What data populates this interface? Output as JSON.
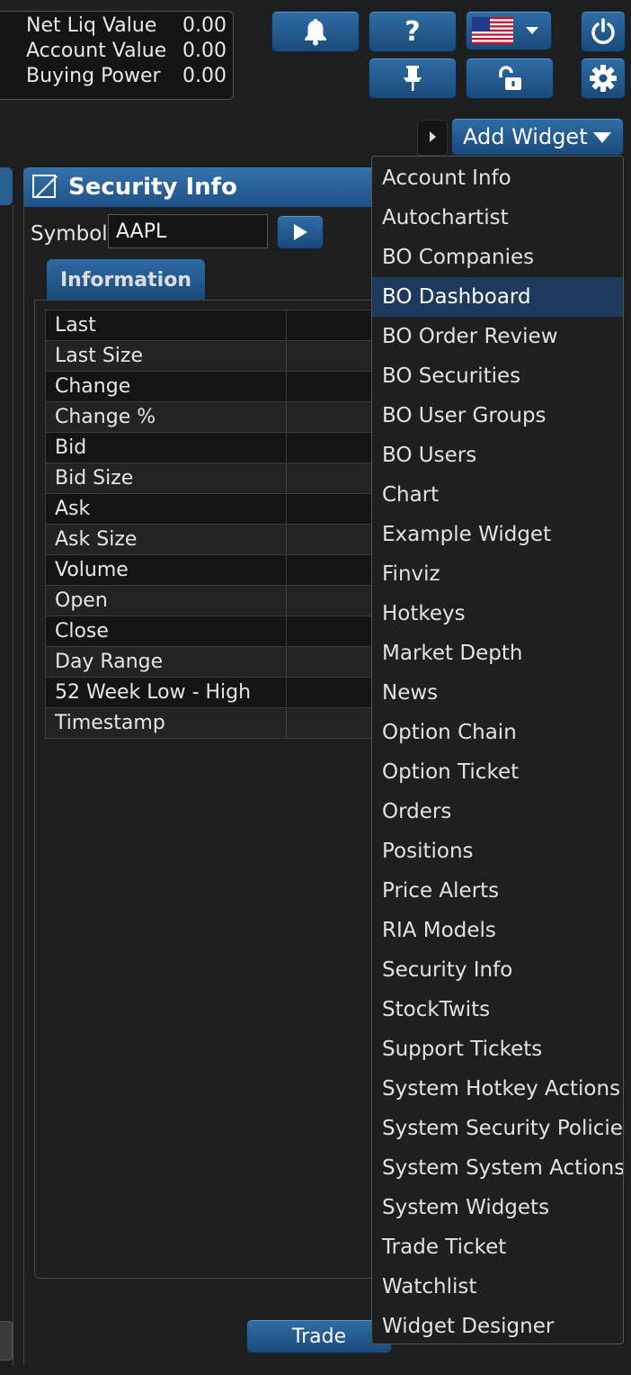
{
  "account": {
    "rows": [
      {
        "label": "Net Liq Value",
        "value": "0.00"
      },
      {
        "label": "Account Value",
        "value": "0.00"
      },
      {
        "label": "Buying Power",
        "value": "0.00"
      }
    ]
  },
  "toolbar": {
    "help_label": "?",
    "add_widget_label": "Add Widget"
  },
  "panel": {
    "title": "Security Info",
    "symbol_label": "Symbol",
    "symbol_value": "AAPL",
    "tab_label": "Information",
    "rows": [
      "Last",
      "Last Size",
      "Change",
      "Change %",
      "Bid",
      "Bid Size",
      "Ask",
      "Ask Size",
      "Volume",
      "Open",
      "Close",
      "Day Range",
      "52 Week Low - High",
      "Timestamp"
    ],
    "trade_label": "Trade"
  },
  "menu": {
    "selected_index": 3,
    "items": [
      "Account Info",
      "Autochartist",
      "BO Companies",
      "BO Dashboard",
      "BO Order Review",
      "BO Securities",
      "BO User Groups",
      "BO Users",
      "Chart",
      "Example Widget",
      "Finviz",
      "Hotkeys",
      "Market Depth",
      "News",
      "Option Chain",
      "Option Ticket",
      "Orders",
      "Positions",
      "Price Alerts",
      "RIA Models",
      "Security Info",
      "StockTwits",
      "Support Tickets",
      "System Hotkey Actions",
      "System Security Policies",
      "System System Actions",
      "System Widgets",
      "Trade Ticket",
      "Watchlist",
      "Widget Designer"
    ]
  },
  "colors": {
    "accent": "#2f6da6",
    "selected": "#1c3a5c",
    "background": "#1e1e1e"
  },
  "icons": [
    "bell-icon",
    "help-icon",
    "us-flag-icon",
    "chevron-down-icon",
    "power-icon",
    "pin-icon",
    "unlock-icon",
    "gear-icon",
    "play-icon",
    "chevron-right-icon"
  ]
}
